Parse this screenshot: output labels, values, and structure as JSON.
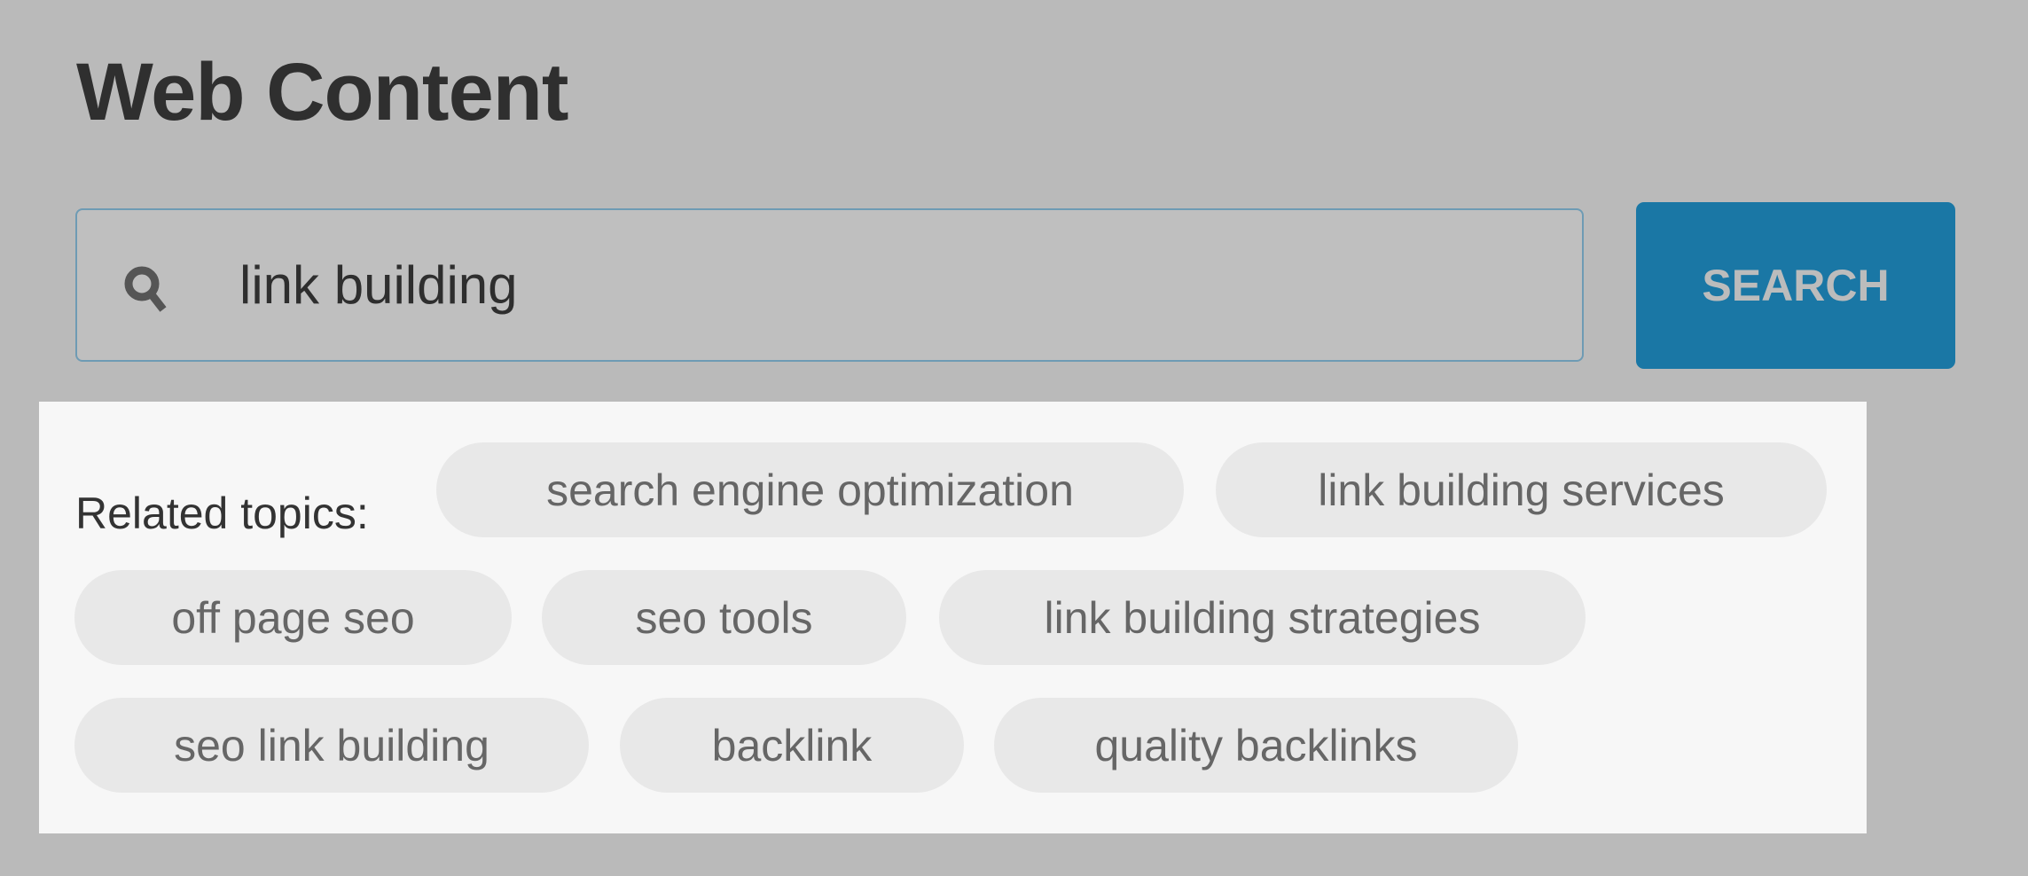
{
  "page": {
    "title": "Web Content"
  },
  "search": {
    "value": "link building",
    "icon": "search-icon",
    "button_label": "SEARCH"
  },
  "related": {
    "label": "Related topics:",
    "topics": [
      "search engine optimization",
      "link building services",
      "off page seo",
      "seo tools",
      "link building strategies",
      "seo link building",
      "backlink",
      "quality backlinks"
    ]
  },
  "colors": {
    "accent": "#1a77a5",
    "input_border": "#6e9bb4",
    "chip_bg": "#e8e8e8",
    "panel_bg": "#f7f7f7",
    "page_bg": "#bababa"
  }
}
